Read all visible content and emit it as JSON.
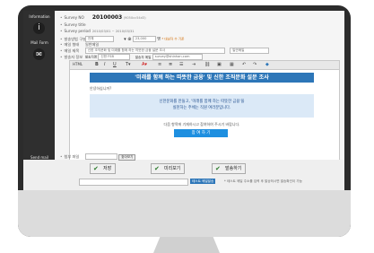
{
  "sidebar": {
    "information_label": "Information",
    "mail_form_label": "Mail Form",
    "send_mail_label": "Send mail"
  },
  "info": {
    "survey_no_label": "Survey NO",
    "survey_no_value": "20100003",
    "survey_no_suffix": "(9050cc54d3)",
    "survey_title_label": "Survey title",
    "survey_period_label": "Survey period",
    "survey_period_value": "2010/03/01 ~ 2010/03/31"
  },
  "form": {
    "method_label": "발송방법 구분",
    "method_value": "전체",
    "count_value": "23,000",
    "count_unit": "명",
    "count_note": "* 대상자 수 기준",
    "type_label": "메일 형태",
    "type_value": "일반메일",
    "subject_label": "메일 제목",
    "subject_value": "신한 조직문화 및 미래를 함께 하는 따뜻한 금융 설문 조사",
    "subject_option": "일반메일",
    "sender_label": "발송자 정보",
    "sender_name_label": "발송자명",
    "sender_name_value": "신한 FSB",
    "sender_mail_label": "발송자 메일",
    "sender_mail_value": "survey@shinhan.com"
  },
  "editor": {
    "toolbar_style": "HTML",
    "title": "'미래를 함께 하는 따뜻한 금융' 및 신한 조직문화 설문 조사",
    "greeting": "안녕하십니까?",
    "line1": "신한문화를 만들고, '미래를 함께 하는 따뜻한 금융'을",
    "line2": "실천하는 주체는 직원 여러분입니다.",
    "note": "다음 항목에 기재하시고 참여하여 주시기 바랍니다.",
    "go_button": "참 여 하 기"
  },
  "attach": {
    "label": "첨부 파일",
    "button": "찾아보기"
  },
  "actions": {
    "save": "저장",
    "preview": "미리보기",
    "send": "발송하기",
    "test_mail_button": "테스트 메일발송",
    "test_mail_note": "* 테스트 메일 주소를 입력 후 발송하시면 발송확인이 가능"
  },
  "colors": {
    "accent": "#2d76b8",
    "button_blue": "#1e8fe0",
    "panel_dark": "#2f2f2f"
  },
  "icons": [
    "info-icon",
    "envelope-icon",
    "send-icon",
    "check-icon"
  ]
}
